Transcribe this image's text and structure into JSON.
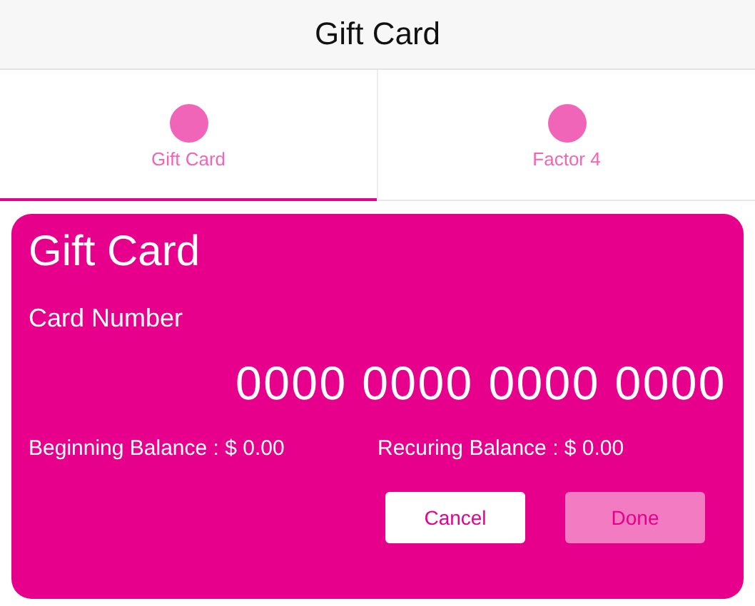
{
  "header": {
    "title": "Gift Card"
  },
  "tabs": [
    {
      "label": "Gift Card",
      "selected": true
    },
    {
      "label": "Factor 4",
      "selected": false
    }
  ],
  "card": {
    "title": "Gift Card",
    "number_label": "Card Number",
    "number": "0000 0000 0000 0000",
    "balances": [
      {
        "text": "Beginning Balance : $ 0.00"
      },
      {
        "text": "Recuring Balance : $ 0.00"
      }
    ],
    "buttons": [
      {
        "label": "Cancel",
        "disabled": false
      },
      {
        "label": "Done",
        "disabled": true
      }
    ]
  }
}
